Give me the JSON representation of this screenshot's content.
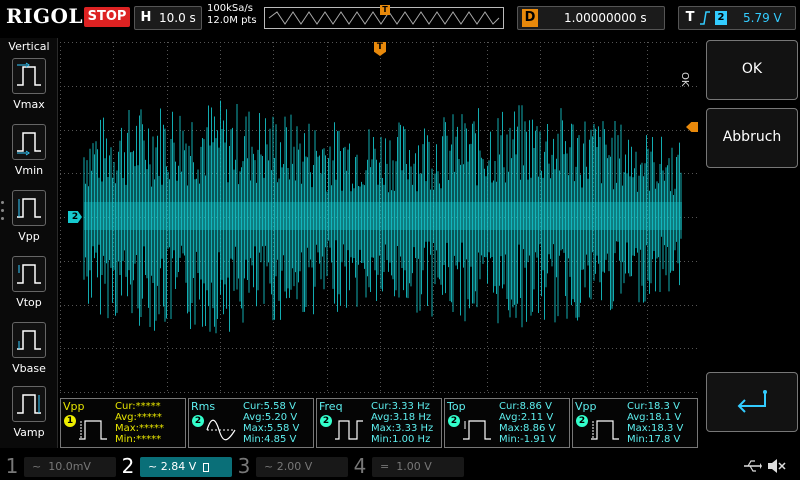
{
  "top": {
    "brand": "RIGOL",
    "run_state": "STOP",
    "horizontal_key": "H",
    "timebase": "10.0 s",
    "sample_rate": "100kSa/s",
    "memory_depth": "12.0M pts",
    "trigger_marker": "T",
    "delay_key": "D",
    "delay": "1.00000000 s",
    "trigger_key": "T",
    "trigger_source": "2",
    "trigger_level": "5.79 V"
  },
  "sidebar": {
    "title": "Vertical",
    "items": [
      {
        "label": "Vmax"
      },
      {
        "label": "Vmin"
      },
      {
        "label": "Vpp"
      },
      {
        "label": "Vtop"
      },
      {
        "label": "Vbase"
      },
      {
        "label": "Vamp"
      }
    ]
  },
  "plot": {
    "trace_color": "#16c9cf",
    "ch2_marker": "2",
    "trigger_marker": "T"
  },
  "right": {
    "ok_side": "OK",
    "ok_label": "OK",
    "cancel_label": "Abbruch"
  },
  "measurements": [
    {
      "name": "Vpp",
      "channel": "1",
      "cur": "Cur:*****",
      "avg": "Avg:*****",
      "max": "Max:*****",
      "min": "Min:*****",
      "color": "yellow"
    },
    {
      "name": "Rms",
      "channel": "2",
      "cur": "Cur:5.58 V",
      "avg": "Avg:5.20 V",
      "max": "Max:5.58 V",
      "min": "Min:4.85 V",
      "color": "cyan"
    },
    {
      "name": "Freq",
      "channel": "2",
      "cur": "Cur:3.33 Hz",
      "avg": "Avg:3.18 Hz",
      "max": "Max:3.33 Hz",
      "min": "Min:1.00 Hz",
      "color": "cyan"
    },
    {
      "name": "Top",
      "channel": "2",
      "cur": "Cur:8.86 V",
      "avg": "Avg:2.11 V",
      "max": "Max:8.86 V",
      "min": "Min:-1.91 V",
      "color": "cyan"
    },
    {
      "name": "Vpp",
      "channel": "2",
      "cur": "Cur:18.3 V",
      "avg": "Avg:18.1 V",
      "max": "Max:18.3 V",
      "min": "Min:17.8 V",
      "color": "cyan"
    }
  ],
  "channels": [
    {
      "num": "1",
      "scale": "10.0mV",
      "coupling_icon": "~"
    },
    {
      "num": "2",
      "scale": "2.84 V",
      "coupling_icon": "~"
    },
    {
      "num": "3",
      "scale": "2.00 V",
      "coupling_icon": "~"
    },
    {
      "num": "4",
      "scale": "1.00 V",
      "coupling_icon": "="
    }
  ]
}
